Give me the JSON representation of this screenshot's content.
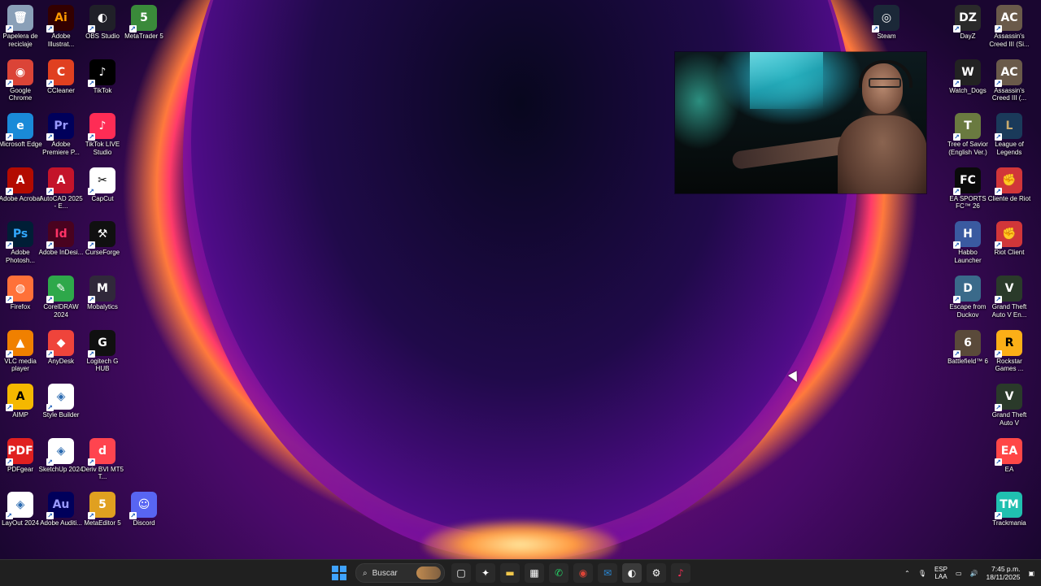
{
  "desktop": {
    "left_icons": [
      {
        "label": "Papelera de reciclaje",
        "icon": "recycle-bin-icon",
        "glyph": "🗑",
        "bg": "#8aa0b8"
      },
      {
        "label": "Adobe Illustrat...",
        "icon": "illustrator-icon",
        "glyph": "Ai",
        "bg": "#330000",
        "fg": "#ff9a00"
      },
      {
        "label": "OBS Studio",
        "icon": "obs-icon",
        "glyph": "◐",
        "bg": "#202028"
      },
      {
        "label": "MetaTrader 5",
        "icon": "metatrader-icon",
        "glyph": "5",
        "bg": "#3a8a3a"
      },
      {
        "label": "Google Chrome",
        "icon": "chrome-icon",
        "glyph": "◉",
        "bg": "#db4437"
      },
      {
        "label": "CCleaner",
        "icon": "ccleaner-icon",
        "glyph": "C",
        "bg": "#e04020"
      },
      {
        "label": "TikTok",
        "icon": "tiktok-icon",
        "glyph": "♪",
        "bg": "#000000"
      },
      {
        "label": "Microsoft Edge",
        "icon": "edge-icon",
        "glyph": "e",
        "bg": "#1a8ad8"
      },
      {
        "label": "Adobe Premiere P...",
        "icon": "premiere-icon",
        "glyph": "Pr",
        "bg": "#00005b",
        "fg": "#9999ff"
      },
      {
        "label": "TikTok LIVE Studio",
        "icon": "tiktok-live-icon",
        "glyph": "♪",
        "bg": "#fe2c55"
      },
      {
        "label": "Adobe Acrobat",
        "icon": "acrobat-icon",
        "glyph": "A",
        "bg": "#b30b00"
      },
      {
        "label": "AutoCAD 2025 - E...",
        "icon": "autocad-icon",
        "glyph": "A",
        "bg": "#c4142a"
      },
      {
        "label": "CapCut",
        "icon": "capcut-icon",
        "glyph": "✂",
        "bg": "#ffffff",
        "fg": "#000000"
      },
      {
        "label": "Adobe Photosh...",
        "icon": "photoshop-icon",
        "glyph": "Ps",
        "bg": "#001e36",
        "fg": "#31a8ff"
      },
      {
        "label": "Adobe InDesi...",
        "icon": "indesign-icon",
        "glyph": "Id",
        "bg": "#49021f",
        "fg": "#ff3366"
      },
      {
        "label": "CurseForge",
        "icon": "curseforge-icon",
        "glyph": "⚒",
        "bg": "#101010"
      },
      {
        "label": "Firefox",
        "icon": "firefox-icon",
        "glyph": "◍",
        "bg": "#ff7139"
      },
      {
        "label": "CorelDRAW 2024",
        "icon": "coreldraw-icon",
        "glyph": "✎",
        "bg": "#2ea84a"
      },
      {
        "label": "Mobalytics",
        "icon": "mobalytics-icon",
        "glyph": "M",
        "bg": "#30283a"
      },
      {
        "label": "VLC media player",
        "icon": "vlc-icon",
        "glyph": "▲",
        "bg": "#f08000"
      },
      {
        "label": "AnyDesk",
        "icon": "anydesk-icon",
        "glyph": "◆",
        "bg": "#ef443b"
      },
      {
        "label": "Logitech G HUB",
        "icon": "logitech-icon",
        "glyph": "G",
        "bg": "#101010"
      },
      {
        "label": "AIMP",
        "icon": "aimp-icon",
        "glyph": "A",
        "bg": "#f5b800",
        "fg": "#000000"
      },
      {
        "label": "Style Builder",
        "icon": "style-builder-icon",
        "glyph": "◈",
        "bg": "#ffffff",
        "fg": "#2a6ab0"
      },
      {
        "label": "PDFgear",
        "icon": "pdfgear-icon",
        "glyph": "PDF",
        "bg": "#e02020"
      },
      {
        "label": "SketchUp 2024",
        "icon": "sketchup-icon",
        "glyph": "◈",
        "bg": "#ffffff",
        "fg": "#2a6ab0"
      },
      {
        "label": "Deriv BVI MT5 T...",
        "icon": "deriv-icon",
        "glyph": "d",
        "bg": "#ff444f"
      },
      {
        "label": "LayOut 2024",
        "icon": "layout-icon",
        "glyph": "◈",
        "bg": "#ffffff",
        "fg": "#2a6ab0"
      },
      {
        "label": "Adobe Auditi...",
        "icon": "audition-icon",
        "glyph": "Au",
        "bg": "#00005b",
        "fg": "#9999ff"
      },
      {
        "label": "MetaEditor 5",
        "icon": "metaeditor-icon",
        "glyph": "5",
        "bg": "#e0a020"
      },
      {
        "label": "Discord",
        "icon": "discord-icon",
        "glyph": "☺",
        "bg": "#5865f2"
      }
    ],
    "right_icons": [
      {
        "label": "Steam",
        "icon": "steam-icon",
        "glyph": "◎",
        "bg": "#1b2838"
      },
      {
        "label": "DayZ",
        "icon": "dayz-icon",
        "glyph": "DZ",
        "bg": "#2a2a2a"
      },
      {
        "label": "Assassin's Creed III (Si...",
        "icon": "assassins-creed-icon",
        "glyph": "AC",
        "bg": "#6a5a4a"
      },
      {
        "label": "Watch_Dogs",
        "icon": "watch-dogs-icon",
        "glyph": "W",
        "bg": "#222222"
      },
      {
        "label": "Assassin's Creed III (...",
        "icon": "assassins-creed-icon",
        "glyph": "AC",
        "bg": "#6a5a4a"
      },
      {
        "label": "Tree of Savior (English Ver.)",
        "icon": "tree-of-savior-icon",
        "glyph": "T",
        "bg": "#6a7a40"
      },
      {
        "label": "League of Legends",
        "icon": "league-icon",
        "glyph": "L",
        "bg": "#1a3a5a",
        "fg": "#c8aa6e"
      },
      {
        "label": "EA SPORTS FC™ 26",
        "icon": "ea-fc-icon",
        "glyph": "FC",
        "bg": "#0a0a0a"
      },
      {
        "label": "Cliente de Riot",
        "icon": "riot-icon",
        "glyph": "✊",
        "bg": "#d13639"
      },
      {
        "label": "Habbo Launcher",
        "icon": "habbo-icon",
        "glyph": "H",
        "bg": "#3a5aa0"
      },
      {
        "label": "Riot Client",
        "icon": "riot-icon",
        "glyph": "✊",
        "bg": "#d13639"
      },
      {
        "label": "Escape from Duckov",
        "icon": "duckov-icon",
        "glyph": "D",
        "bg": "#3a6a8a"
      },
      {
        "label": "Grand Theft Auto V En...",
        "icon": "gta-icon",
        "glyph": "V",
        "bg": "#2a3a2a"
      },
      {
        "label": "Battlefield™ 6",
        "icon": "battlefield-icon",
        "glyph": "6",
        "bg": "#5a4a3a"
      },
      {
        "label": "Rockstar Games ...",
        "icon": "rockstar-icon",
        "glyph": "R",
        "bg": "#fcaf17",
        "fg": "#000000"
      },
      {
        "label": "Grand Theft Auto V",
        "icon": "gta-icon",
        "glyph": "V",
        "bg": "#2a3a2a"
      },
      {
        "label": "EA",
        "icon": "ea-icon",
        "glyph": "EA",
        "bg": "#ff4747"
      },
      {
        "label": "Trackmania",
        "icon": "trackmania-icon",
        "glyph": "TM",
        "bg": "#20c0b0"
      }
    ]
  },
  "taskbar": {
    "search_placeholder": "Buscar",
    "apps": [
      {
        "icon": "task-view-icon",
        "glyph": "▢",
        "bg": "#2a2a2a"
      },
      {
        "icon": "copilot-icon",
        "glyph": "✦",
        "bg": "#2a2a2a"
      },
      {
        "icon": "file-explorer-icon",
        "glyph": "▬",
        "bg": "#2a2a2a",
        "fg": "#f2c84b"
      },
      {
        "icon": "microsoft-store-icon",
        "glyph": "▦",
        "bg": "#2a2a2a"
      },
      {
        "icon": "whatsapp-icon",
        "glyph": "✆",
        "bg": "#2a2a2a",
        "fg": "#25d366"
      },
      {
        "icon": "chrome-icon",
        "glyph": "◉",
        "bg": "#2a2a2a",
        "fg": "#db4437"
      },
      {
        "icon": "outlook-icon",
        "glyph": "✉",
        "bg": "#2a2a2a",
        "fg": "#2a8ad8"
      },
      {
        "icon": "obs-icon",
        "glyph": "◐",
        "bg": "#3a3a3a"
      },
      {
        "icon": "settings-icon",
        "glyph": "⚙",
        "bg": "#2a2a2a"
      },
      {
        "icon": "tiktok-live-icon",
        "glyph": "♪",
        "bg": "#2a2a2a",
        "fg": "#fe2c55"
      }
    ],
    "tray": {
      "lang_1": "ESP",
      "lang_2": "LAA",
      "time": "7:45 p.m.",
      "date": "18/11/2025"
    }
  }
}
